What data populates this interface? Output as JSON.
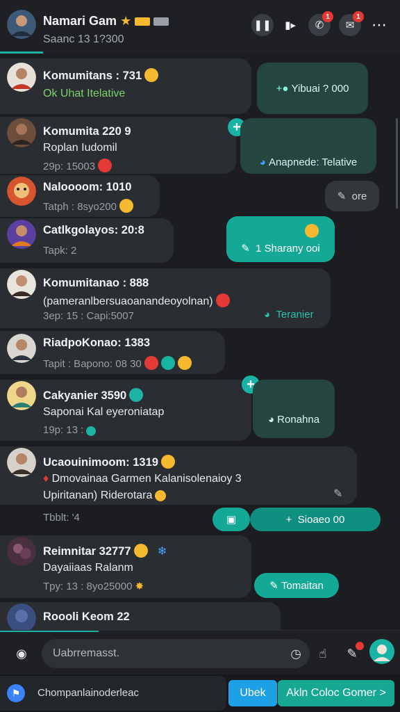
{
  "header": {
    "title": "Namari Gam",
    "subtitle": "Saanc 13 1?300",
    "badge_count": "1"
  },
  "conversations": [
    {
      "name": "Komumitans : 731",
      "line": "Ok  Uhat Itelative",
      "meta": "",
      "reply": "Yibuai ? 000"
    },
    {
      "name": "Komumita  220 9",
      "line": "Roplan Iudomil",
      "meta": "29p: 15003",
      "reply": "Anapnede: Telative"
    },
    {
      "name": "Naloooom: 1010",
      "line": "",
      "meta": "Tatph : 8syo200",
      "reply": "ore"
    },
    {
      "name": "Catlkgolayos: 20:8",
      "line": "",
      "meta": "Tapk: 2",
      "reply": "1 Sharany ooi"
    },
    {
      "name": "Komumitanao : 888",
      "line": "(pameranlbersuaoanandeoyolnan)",
      "meta": "3ep: 15 : Capi:5007",
      "reply": "Teranier"
    },
    {
      "name": "RiadpoKonao: 1383",
      "line": "",
      "meta": "Tapit : Bapono: 08 30",
      "reply": ""
    },
    {
      "name": "Cakyanier  3590",
      "line": "Saponai Kal eyeroniatap",
      "meta": "19p: 13 :",
      "reply": "Ronahna"
    },
    {
      "name": "Ucaouinimoom: 1319",
      "line": "Dmovainaa Garmen Kalanisolenaioy 3",
      "line2": "Upiritanan) Riderotara",
      "meta": "",
      "reply": ""
    },
    {
      "name": "Reimnitar  32777",
      "line": "Dayaiiaas Ralanm",
      "meta": "Tpy: 13 : 8yo25000",
      "reply": "Tomaitan"
    },
    {
      "name": "Roooli Keom 22",
      "line": "",
      "meta": "",
      "reply": ""
    }
  ],
  "inline_status": {
    "label": "Tbblt: '4",
    "action": "Sioaeo 00"
  },
  "composer": {
    "placeholder": "Uabrremasst."
  },
  "bottom": {
    "text": "Chompanlainoderleac",
    "button1": "Ubek",
    "button2": "Akln Coloc Gomer >"
  },
  "colors": {
    "accent": "#19b3a6",
    "bubble": "#2a2d31",
    "background": "#1b1d20"
  }
}
